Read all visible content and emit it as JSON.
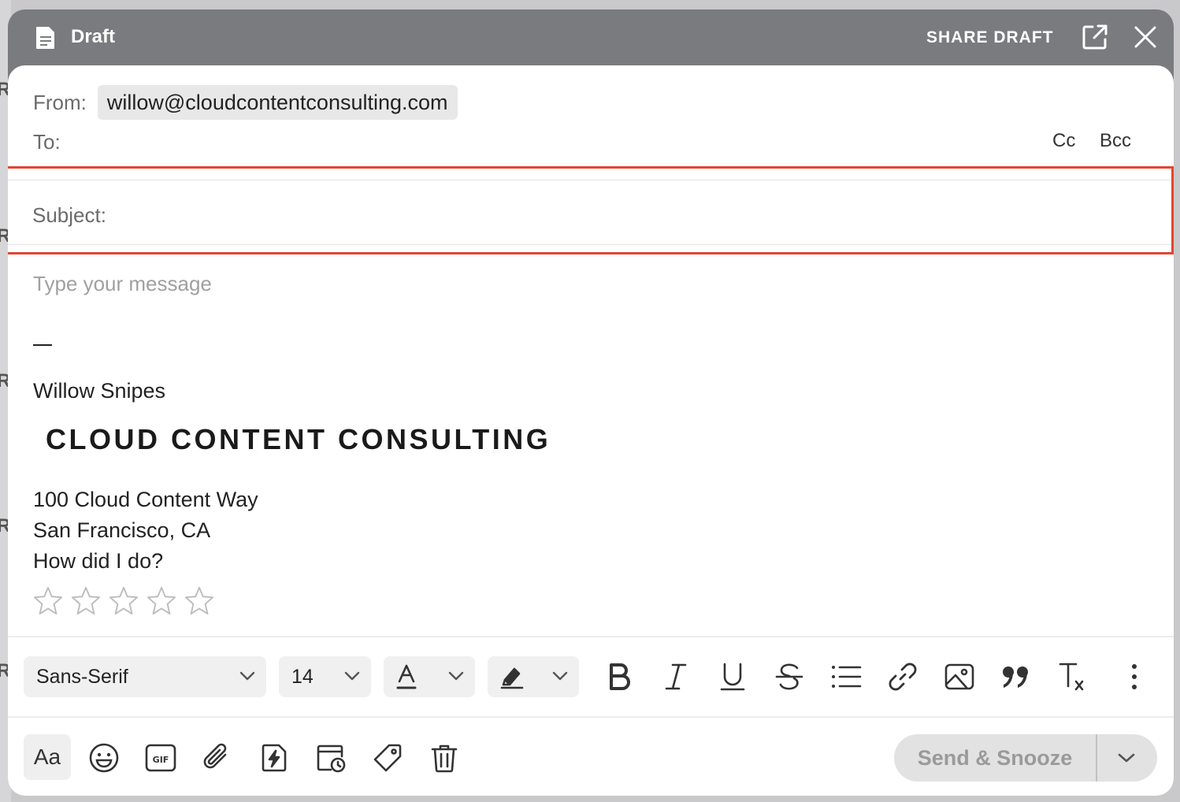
{
  "window": {
    "title": "Draft",
    "share_label": "SHARE DRAFT"
  },
  "header": {
    "from_label": "From:",
    "from_value": "willow@cloudcontentconsulting.com",
    "to_label": "To:",
    "cc_label": "Cc",
    "bcc_label": "Bcc",
    "subject_label": "Subject:"
  },
  "body": {
    "placeholder": "Type your message",
    "signature": {
      "dash": "—",
      "name": "Willow Snipes",
      "logo_text": "CLOUD CONTENT CONSULTING",
      "address_line1": "100 Cloud Content Way",
      "address_line2": "San Francisco, CA",
      "rating_prompt": "How did I do?",
      "rating_stars": 5,
      "rating_value": 0
    }
  },
  "toolbar": {
    "font_family": "Sans-Serif",
    "font_size": "14"
  },
  "bottom": {
    "text_format_label": "Aa",
    "send_label": "Send & Snooze"
  },
  "colors": {
    "titlebar": "#7a7b7e",
    "highlight_border": "#e2462f",
    "send_bg": "#e2e2e3"
  }
}
